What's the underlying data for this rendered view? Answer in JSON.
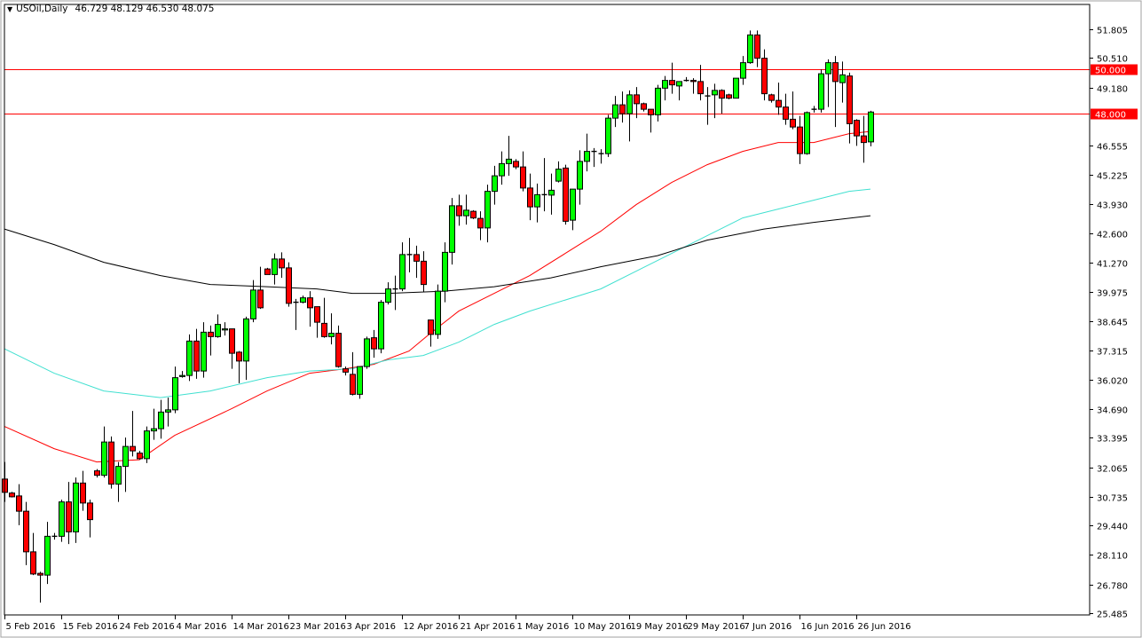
{
  "header": {
    "symbol": "USOil,Daily",
    "ohlc": "46.729 48.129 46.530 48.075",
    "menu_icon": "triangle-down-icon"
  },
  "colors": {
    "bull": "#00ff00",
    "bear": "#ff0000",
    "outline": "#000000",
    "ma_fast": "#ff0000",
    "ma_mid": "#40e0d0",
    "ma_slow": "#000000",
    "level_line": "#ff0000",
    "level_label_bg": "#ff0000",
    "level_label_text": "#ffffff"
  },
  "chart_data": {
    "type": "candlestick",
    "title": "USOil,Daily",
    "ylim": [
      25.485,
      53.0
    ],
    "y_ticks": [
      "51.805",
      "50.510",
      "49.180",
      "46.555",
      "45.225",
      "43.930",
      "42.600",
      "41.270",
      "39.975",
      "38.645",
      "37.315",
      "36.020",
      "34.690",
      "33.395",
      "32.065",
      "30.735",
      "29.440",
      "28.110",
      "26.780",
      "25.485"
    ],
    "x_ticks": [
      {
        "bar": 0,
        "label": "5 Feb 2016"
      },
      {
        "bar": 8,
        "label": "15 Feb 2016"
      },
      {
        "bar": 16,
        "label": "24 Feb 2016"
      },
      {
        "bar": 24,
        "label": "4 Mar 2016"
      },
      {
        "bar": 32,
        "label": "14 Mar 2016"
      },
      {
        "bar": 40,
        "label": "23 Mar 2016"
      },
      {
        "bar": 48,
        "label": "3 Apr 2016"
      },
      {
        "bar": 56,
        "label": "12 Apr 2016"
      },
      {
        "bar": 64,
        "label": "21 Apr 2016"
      },
      {
        "bar": 72,
        "label": "1 May 2016"
      },
      {
        "bar": 80,
        "label": "10 May 2016"
      },
      {
        "bar": 88,
        "label": "19 May 2016"
      },
      {
        "bar": 96,
        "label": "29 May 2016"
      },
      {
        "bar": 104,
        "label": "7 Jun 2016"
      },
      {
        "bar": 112,
        "label": "16 Jun 2016"
      },
      {
        "bar": 120,
        "label": "26 Jun 2016"
      }
    ],
    "levels": [
      {
        "value": 50.0,
        "label": "50.000"
      },
      {
        "value": 48.0,
        "label": "48.000"
      }
    ],
    "ohlc_fields": [
      "open",
      "high",
      "low",
      "close"
    ],
    "candles": [
      [
        31.53,
        32.3,
        30.5,
        30.93
      ],
      [
        30.9,
        30.95,
        30.7,
        30.73
      ],
      [
        30.77,
        31.3,
        29.45,
        30.08
      ],
      [
        30.08,
        30.5,
        27.65,
        28.25
      ],
      [
        28.25,
        29.1,
        27.2,
        27.25
      ],
      [
        27.28,
        27.35,
        25.96,
        27.2
      ],
      [
        27.2,
        29.6,
        26.8,
        28.95
      ],
      [
        28.95,
        29.1,
        28.8,
        28.95
      ],
      [
        28.95,
        30.6,
        28.7,
        30.5
      ],
      [
        30.5,
        31.4,
        28.6,
        29.15
      ],
      [
        29.15,
        31.6,
        28.65,
        31.35
      ],
      [
        31.35,
        31.9,
        30.1,
        30.45
      ],
      [
        30.45,
        30.6,
        28.9,
        29.7
      ],
      [
        31.9,
        31.98,
        31.6,
        31.7
      ],
      [
        31.7,
        33.9,
        31.6,
        33.2
      ],
      [
        33.2,
        33.45,
        31.1,
        31.3
      ],
      [
        31.3,
        32.3,
        30.5,
        32.1
      ],
      [
        32.1,
        33.4,
        30.95,
        33.0
      ],
      [
        33.0,
        34.6,
        32.55,
        32.8
      ],
      [
        32.7,
        32.8,
        32.4,
        32.45
      ],
      [
        32.45,
        33.9,
        32.25,
        33.7
      ],
      [
        33.7,
        34.7,
        33.3,
        33.8
      ],
      [
        33.8,
        35.1,
        33.35,
        34.55
      ],
      [
        34.55,
        35.2,
        33.9,
        34.65
      ],
      [
        34.65,
        36.6,
        34.5,
        36.1
      ],
      [
        36.15,
        36.4,
        36.1,
        36.2
      ],
      [
        36.2,
        38.05,
        35.95,
        37.75
      ],
      [
        37.75,
        38.3,
        36.05,
        36.4
      ],
      [
        36.4,
        38.6,
        36.1,
        38.15
      ],
      [
        38.15,
        38.45,
        37.1,
        37.95
      ],
      [
        37.95,
        38.95,
        37.9,
        38.5
      ],
      [
        38.25,
        38.6,
        38.0,
        38.3
      ],
      [
        38.3,
        38.3,
        36.5,
        37.2
      ],
      [
        37.25,
        37.3,
        35.85,
        36.85
      ],
      [
        36.85,
        38.85,
        36.0,
        38.75
      ],
      [
        38.75,
        40.5,
        38.6,
        40.05
      ],
      [
        40.05,
        41.1,
        39.2,
        39.25
      ],
      [
        41.0,
        41.05,
        40.75,
        40.75
      ],
      [
        40.75,
        41.7,
        40.3,
        41.45
      ],
      [
        41.45,
        41.75,
        40.6,
        41.05
      ],
      [
        41.05,
        41.3,
        39.3,
        39.45
      ],
      [
        39.5,
        39.65,
        38.25,
        39.5
      ],
      [
        39.5,
        39.8,
        39.45,
        39.7
      ],
      [
        39.7,
        40.0,
        38.4,
        39.25
      ],
      [
        39.3,
        39.3,
        37.9,
        38.6
      ],
      [
        38.55,
        39.7,
        37.9,
        37.95
      ],
      [
        37.95,
        39.0,
        37.6,
        38.1
      ],
      [
        38.1,
        38.45,
        36.55,
        36.6
      ],
      [
        36.5,
        36.6,
        36.2,
        36.35
      ],
      [
        36.25,
        37.25,
        35.3,
        35.35
      ],
      [
        35.35,
        36.6,
        35.15,
        36.6
      ],
      [
        36.6,
        37.95,
        36.5,
        37.85
      ],
      [
        37.9,
        38.25,
        37.0,
        37.4
      ],
      [
        37.4,
        39.6,
        37.2,
        39.5
      ],
      [
        39.5,
        40.4,
        39.4,
        40.1
      ],
      [
        40.1,
        40.7,
        39.15,
        40.1
      ],
      [
        40.1,
        42.2,
        40.0,
        41.65
      ],
      [
        41.65,
        42.4,
        40.85,
        41.65
      ],
      [
        41.65,
        42.05,
        40.6,
        41.35
      ],
      [
        41.35,
        41.8,
        39.95,
        40.3
      ],
      [
        38.7,
        38.7,
        37.5,
        38.05
      ],
      [
        38.05,
        40.3,
        37.85,
        40.0
      ],
      [
        40.0,
        42.2,
        39.5,
        41.75
      ],
      [
        41.75,
        44.2,
        41.2,
        43.85
      ],
      [
        43.85,
        44.35,
        42.95,
        43.4
      ],
      [
        43.4,
        44.35,
        43.0,
        43.65
      ],
      [
        43.6,
        43.65,
        43.25,
        43.3
      ],
      [
        43.28,
        43.6,
        42.3,
        42.85
      ],
      [
        42.85,
        44.8,
        42.2,
        44.5
      ],
      [
        44.5,
        45.65,
        43.9,
        45.2
      ],
      [
        45.2,
        46.3,
        44.8,
        45.75
      ],
      [
        45.75,
        47.0,
        45.2,
        45.95
      ],
      [
        45.85,
        45.95,
        45.5,
        45.6
      ],
      [
        45.6,
        46.3,
        44.5,
        44.65
      ],
      [
        44.65,
        45.3,
        43.2,
        43.8
      ],
      [
        43.8,
        44.85,
        43.1,
        44.35
      ],
      [
        44.35,
        46.0,
        43.6,
        44.35
      ],
      [
        44.33,
        45.3,
        43.45,
        44.55
      ],
      [
        44.96,
        45.85,
        44.9,
        45.5
      ],
      [
        45.55,
        45.7,
        43.0,
        43.15
      ],
      [
        43.2,
        44.6,
        42.75,
        44.6
      ],
      [
        44.6,
        46.35,
        43.9,
        45.85
      ],
      [
        45.85,
        47.1,
        45.4,
        46.3
      ],
      [
        46.3,
        46.45,
        45.6,
        46.3
      ],
      [
        46.2,
        46.4,
        45.75,
        46.2
      ],
      [
        46.2,
        47.95,
        46.05,
        47.8
      ],
      [
        47.8,
        48.8,
        47.4,
        48.4
      ],
      [
        48.4,
        49.0,
        47.6,
        48.0
      ],
      [
        48.0,
        49.05,
        46.75,
        48.85
      ],
      [
        48.85,
        49.2,
        47.8,
        48.45
      ],
      [
        48.45,
        48.5,
        48.1,
        48.2
      ],
      [
        48.2,
        48.2,
        47.15,
        47.95
      ],
      [
        47.95,
        49.3,
        47.65,
        49.15
      ],
      [
        49.15,
        49.7,
        48.6,
        49.5
      ],
      [
        49.5,
        50.3,
        48.9,
        49.3
      ],
      [
        49.25,
        49.45,
        48.6,
        49.45
      ],
      [
        49.5,
        49.65,
        49.45,
        49.5
      ],
      [
        49.5,
        49.6,
        48.9,
        49.45
      ],
      [
        49.45,
        50.2,
        48.6,
        48.9
      ],
      [
        48.8,
        49.2,
        47.5,
        48.8
      ],
      [
        48.85,
        49.35,
        47.8,
        49.05
      ],
      [
        49.05,
        49.1,
        48.0,
        48.7
      ],
      [
        48.85,
        48.9,
        48.65,
        48.7
      ],
      [
        48.7,
        49.6,
        48.7,
        49.6
      ],
      [
        49.6,
        50.6,
        49.3,
        50.3
      ],
      [
        50.3,
        51.75,
        50.25,
        51.55
      ],
      [
        51.55,
        51.75,
        50.1,
        50.5
      ],
      [
        50.5,
        50.9,
        48.6,
        48.9
      ],
      [
        48.85,
        48.9,
        48.5,
        48.6
      ],
      [
        48.6,
        49.4,
        47.95,
        48.3
      ],
      [
        48.3,
        48.9,
        47.5,
        47.75
      ],
      [
        47.75,
        49.0,
        47.3,
        47.4
      ],
      [
        47.4,
        47.9,
        45.73,
        46.2
      ],
      [
        46.2,
        48.1,
        46.15,
        48.05
      ],
      [
        48.2,
        48.35,
        48.05,
        48.2
      ],
      [
        48.2,
        50.0,
        48.05,
        49.8
      ],
      [
        49.8,
        50.45,
        48.3,
        50.3
      ],
      [
        50.3,
        50.6,
        47.4,
        49.45
      ],
      [
        49.4,
        50.35,
        48.5,
        49.75
      ],
      [
        49.7,
        49.85,
        46.66,
        47.55
      ],
      [
        47.7,
        47.75,
        46.55,
        47.0
      ],
      [
        47.0,
        47.9,
        45.79,
        46.7
      ],
      [
        46.729,
        48.129,
        46.53,
        48.075
      ]
    ],
    "moving_averages": [
      {
        "name": "ma-fast",
        "color_key": "ma_fast",
        "points": [
          [
            0,
            33.9
          ],
          [
            7,
            32.9
          ],
          [
            13,
            32.3
          ],
          [
            19,
            32.4
          ],
          [
            24,
            33.5
          ],
          [
            32,
            34.7
          ],
          [
            37,
            35.5
          ],
          [
            43,
            36.3
          ],
          [
            48,
            36.5
          ],
          [
            52,
            36.7
          ],
          [
            57,
            37.3
          ],
          [
            60,
            38.1
          ],
          [
            64,
            39.1
          ],
          [
            69,
            39.9
          ],
          [
            74,
            40.7
          ],
          [
            79,
            41.7
          ],
          [
            84,
            42.7
          ],
          [
            89,
            43.9
          ],
          [
            94,
            44.9
          ],
          [
            99,
            45.7
          ],
          [
            104,
            46.3
          ],
          [
            109,
            46.7
          ],
          [
            114,
            46.7
          ],
          [
            119,
            47.1
          ],
          [
            122,
            47.2
          ]
        ]
      },
      {
        "name": "ma-mid",
        "color_key": "ma_mid",
        "points": [
          [
            0,
            37.4
          ],
          [
            7,
            36.3
          ],
          [
            14,
            35.5
          ],
          [
            22,
            35.2
          ],
          [
            29,
            35.5
          ],
          [
            37,
            36.1
          ],
          [
            43,
            36.4
          ],
          [
            49,
            36.5
          ],
          [
            54,
            36.9
          ],
          [
            59,
            37.1
          ],
          [
            64,
            37.7
          ],
          [
            69,
            38.5
          ],
          [
            74,
            39.1
          ],
          [
            79,
            39.6
          ],
          [
            84,
            40.1
          ],
          [
            89,
            40.9
          ],
          [
            94,
            41.7
          ],
          [
            99,
            42.5
          ],
          [
            104,
            43.3
          ],
          [
            109,
            43.7
          ],
          [
            114,
            44.1
          ],
          [
            119,
            44.5
          ],
          [
            122,
            44.6
          ]
        ]
      },
      {
        "name": "ma-slow",
        "color_key": "ma_slow",
        "points": [
          [
            0,
            42.8
          ],
          [
            7,
            42.1
          ],
          [
            14,
            41.3
          ],
          [
            22,
            40.7
          ],
          [
            29,
            40.3
          ],
          [
            37,
            40.2
          ],
          [
            44,
            40.1
          ],
          [
            49,
            39.9
          ],
          [
            54,
            39.9
          ],
          [
            62,
            40.0
          ],
          [
            69,
            40.2
          ],
          [
            77,
            40.6
          ],
          [
            84,
            41.1
          ],
          [
            92,
            41.6
          ],
          [
            99,
            42.3
          ],
          [
            107,
            42.8
          ],
          [
            114,
            43.1
          ],
          [
            122,
            43.4
          ]
        ]
      }
    ]
  }
}
